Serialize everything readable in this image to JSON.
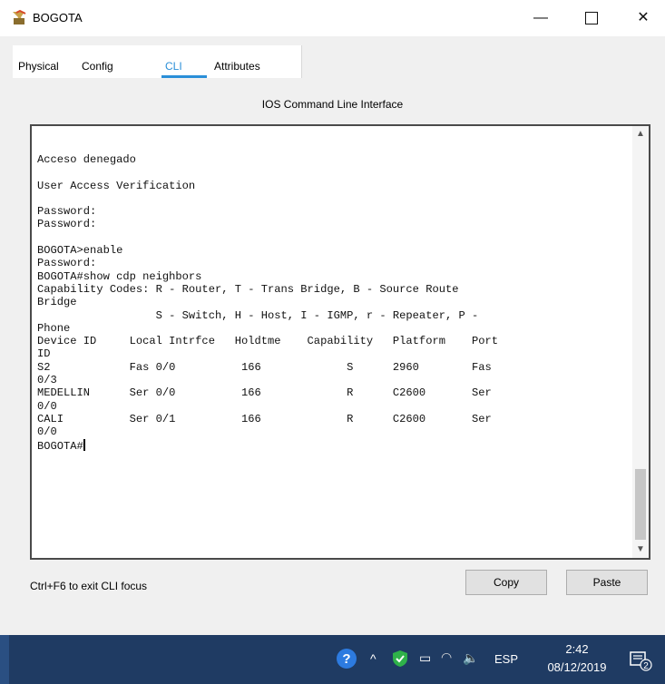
{
  "window": {
    "title": "BOGOTA",
    "minimize": "—",
    "close": "✕"
  },
  "tabs": [
    {
      "label": "Physical"
    },
    {
      "label": "Config"
    },
    {
      "label": "CLI"
    },
    {
      "label": "Attributes"
    }
  ],
  "panel_title": "IOS Command Line Interface",
  "terminal": {
    "lines": [
      "Acceso denegado",
      "",
      "User Access Verification",
      "",
      "Password:",
      "Password:",
      "",
      "BOGOTA>enable",
      "Password:",
      "BOGOTA#show cdp neighbors",
      "Capability Codes: R - Router, T - Trans Bridge, B - Source Route",
      "Bridge",
      "                  S - Switch, H - Host, I - IGMP, r - Repeater, P -",
      "Phone",
      "Device ID     Local Intrfce   Holdtme    Capability   Platform    Port",
      "ID",
      "S2            Fas 0/0          166             S      2960        Fas",
      "0/3",
      "MEDELLIN      Ser 0/0          166             R      C2600       Ser",
      "0/0",
      "CALI          Ser 0/1          166             R      C2600       Ser",
      "0/0"
    ],
    "prompt": "BOGOTA#"
  },
  "hint": "Ctrl+F6 to exit CLI focus",
  "buttons": {
    "copy": "Copy",
    "paste": "Paste"
  },
  "taskbar": {
    "language": "ESP",
    "time": "2:42",
    "date": "08/12/2019",
    "notifications": "2"
  },
  "colors": {
    "accent": "#2a8fd8",
    "taskbar": "#1f3b63"
  }
}
